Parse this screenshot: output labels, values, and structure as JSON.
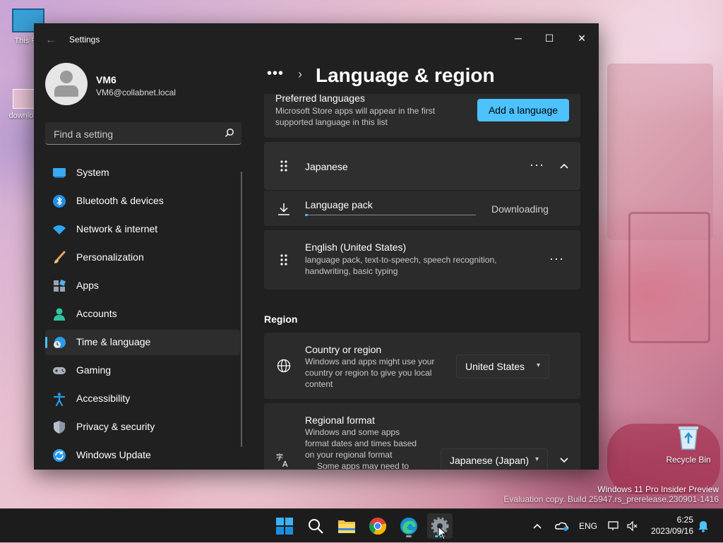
{
  "desktop": {
    "icons": [
      {
        "label": "This PC"
      },
      {
        "label": "download"
      },
      {
        "label": "Recycle Bin"
      }
    ],
    "watermark_line1": "Windows 11 Pro Insider Preview",
    "watermark_line2": "Evaluation copy. Build 25947.rs_prerelease.230901-1416"
  },
  "window": {
    "title": "Settings",
    "controls": {
      "minimize": "─",
      "maximize": "☐",
      "close": "✕"
    }
  },
  "user": {
    "name": "VM6",
    "email": "VM6@collabnet.local"
  },
  "search": {
    "placeholder": "Find a setting"
  },
  "sidebar": {
    "items": [
      {
        "label": "System",
        "icon": "system-icon"
      },
      {
        "label": "Bluetooth & devices",
        "icon": "bluetooth-icon"
      },
      {
        "label": "Network & internet",
        "icon": "network-icon"
      },
      {
        "label": "Personalization",
        "icon": "brush-icon"
      },
      {
        "label": "Apps",
        "icon": "apps-icon"
      },
      {
        "label": "Accounts",
        "icon": "accounts-icon"
      },
      {
        "label": "Time & language",
        "icon": "time-language-icon",
        "active": true
      },
      {
        "label": "Gaming",
        "icon": "gaming-icon"
      },
      {
        "label": "Accessibility",
        "icon": "accessibility-icon"
      },
      {
        "label": "Privacy & security",
        "icon": "shield-icon"
      },
      {
        "label": "Windows Update",
        "icon": "update-icon"
      }
    ]
  },
  "breadcrumb": {
    "overflow": "•••",
    "separator": "›",
    "title": "Language & region"
  },
  "preferred": {
    "heading": "Preferred languages",
    "desc_line1": "Microsoft Store apps will appear in the first",
    "desc_line2": "supported language in this list",
    "add_button": "Add a language"
  },
  "languages": [
    {
      "name": "Japanese",
      "pack_label": "Language pack",
      "pack_status": "Downloading",
      "pack_progress": 0.01
    },
    {
      "name": "English (United States)",
      "features_line1": "language pack, text-to-speech, speech recognition,",
      "features_line2": "handwriting, basic typing"
    }
  ],
  "region": {
    "heading": "Region",
    "country": {
      "title": "Country or region",
      "desc_line1": "Windows and apps might use your",
      "desc_line2": "country or region to give you local",
      "desc_line3": "content",
      "value": "United States"
    },
    "format": {
      "title": "Regional format",
      "desc_line1": "Windows and some apps",
      "desc_line2": "format dates and times based",
      "desc_line3": "on your regional format",
      "desc_line4": "Some apps may need to",
      "value": "Japanese (Japan)"
    }
  },
  "taskbar": {
    "apps": [
      "start-icon",
      "search-icon",
      "file-explorer-icon",
      "chrome-icon",
      "edge-icon",
      "settings-icon"
    ],
    "language": "ENG",
    "time": "6:25",
    "date": "2023/09/16"
  },
  "colors": {
    "accent": "#4cc2ff",
    "window_bg": "#202020",
    "card_bg": "#2b2b2b"
  }
}
